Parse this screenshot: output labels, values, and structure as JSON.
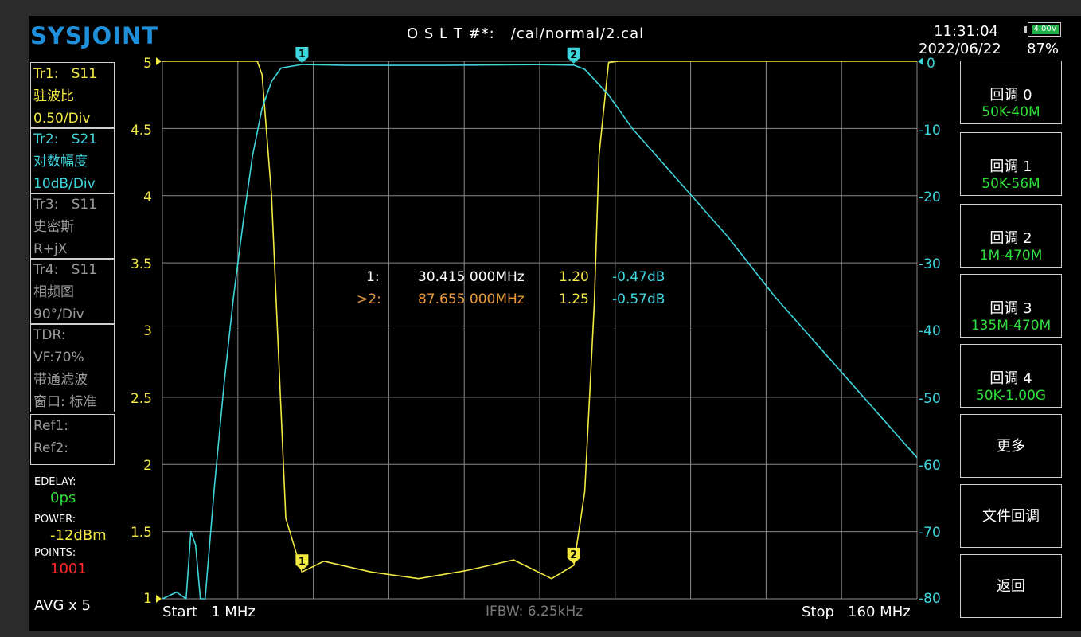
{
  "header": {
    "logo": "SYSJOINT",
    "cal_title": "O S L T #*:   /cal/normal/2.cal",
    "time": "11:31:04",
    "date": "2022/06/22",
    "battery_voltage": "4.00V",
    "battery_percent": "87%"
  },
  "traces": [
    {
      "id": "Tr1:",
      "param": "S11",
      "format": "驻波比",
      "scale": "0.50/Div",
      "color": "#f2ea43"
    },
    {
      "id": "Tr2:",
      "param": "S21",
      "format": "对数幅度",
      "scale": "10dB/Div",
      "color": "#3fd5dc"
    },
    {
      "id": "Tr3:",
      "param": "S11",
      "format": "史密斯",
      "scale": "R+jX",
      "color": "#9a9a9a"
    },
    {
      "id": "Tr4:",
      "param": "S11",
      "format": "相频图",
      "scale": "90°/Div",
      "color": "#9a9a9a"
    }
  ],
  "tdr": {
    "title": "TDR:",
    "vf": "VF:70%",
    "filter": "带通滤波",
    "window": "窗口: 标准"
  },
  "refs": {
    "ref1": "Ref1:",
    "ref2": "Ref2:"
  },
  "settings": {
    "edelay_label": "EDELAY:",
    "edelay_value": "0ps",
    "power_label": "POWER:",
    "power_value": "-12dBm",
    "points_label": "POINTS:",
    "points_value": "1001",
    "avg": "AVG x 5"
  },
  "softkeys": [
    {
      "label": "回调 0",
      "sub": "50K-40M"
    },
    {
      "label": "回调 1",
      "sub": "50K-56M"
    },
    {
      "label": "回调 2",
      "sub": "1M-470M"
    },
    {
      "label": "回调 3",
      "sub": "135M-470M"
    },
    {
      "label": "回调 4",
      "sub": "50K-1.00G"
    },
    {
      "label": "更多",
      "sub": ""
    },
    {
      "label": "文件回调",
      "sub": ""
    },
    {
      "label": "返回",
      "sub": ""
    }
  ],
  "markers": [
    {
      "label": "1:",
      "freq": "30.415 000MHz",
      "vswr": "1.20",
      "db": "-0.47dB",
      "active": false
    },
    {
      "label": ">2:",
      "freq": "87.655 000MHz",
      "vswr": "1.25",
      "db": "-0.57dB",
      "active": true
    }
  ],
  "footer": {
    "start": "Start   1 MHz",
    "ifbw": "IFBW: 6.25kHz",
    "stop": "Stop   160 MHz"
  },
  "chart_data": {
    "type": "line",
    "x_unit": "MHz",
    "xlim": [
      1,
      160
    ],
    "left_axis": {
      "ticks": [
        "5",
        "4.5",
        "4",
        "3.5",
        "3",
        "2.5",
        "2",
        "1.5",
        "1"
      ],
      "ylim": [
        1,
        5
      ]
    },
    "right_axis": {
      "ticks": [
        "0",
        "-10",
        "-20",
        "-30",
        "-40",
        "-50",
        "-60",
        "-70",
        "-80"
      ],
      "ylim": [
        -80,
        0
      ]
    },
    "series": [
      {
        "color": "#f2ea43",
        "axis": "left",
        "x": [
          1,
          10,
          21,
          22,
          24,
          27,
          30.4,
          35,
          45,
          55,
          65,
          75,
          83,
          87.7,
          90,
          92,
          93,
          95,
          97,
          100,
          110,
          130,
          160
        ],
        "y": [
          5,
          5,
          5,
          4.9,
          4,
          1.6,
          1.2,
          1.28,
          1.2,
          1.15,
          1.21,
          1.29,
          1.15,
          1.25,
          1.8,
          3.2,
          4.3,
          4.99,
          5,
          5,
          5,
          5,
          5
        ]
      },
      {
        "color": "#3fd5dc",
        "axis": "right",
        "x": [
          1,
          4,
          6,
          7,
          8,
          9,
          10,
          12,
          14,
          16,
          18,
          20,
          22,
          24,
          26,
          30.4,
          40,
          60,
          80,
          87.7,
          90,
          95,
          100,
          110,
          120,
          130,
          140,
          150,
          160
        ],
        "y": [
          -80,
          -79,
          -80,
          -70,
          -72,
          -80,
          -80,
          -63,
          -48,
          -35,
          -24,
          -14,
          -7,
          -3,
          -1,
          -0.47,
          -0.6,
          -0.6,
          -0.5,
          -0.57,
          -1.2,
          -5,
          -10,
          -18,
          -26,
          -35,
          -43,
          -51,
          -59
        ]
      }
    ],
    "marker_points": [
      {
        "n": "1",
        "x": 30.415,
        "vswr": 1.2,
        "db": -0.47
      },
      {
        "n": "2",
        "x": 87.655,
        "vswr": 1.25,
        "db": -0.57
      }
    ]
  }
}
